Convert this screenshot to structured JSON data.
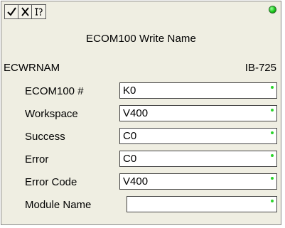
{
  "toolbar": {
    "buttons": [
      {
        "icon": "checkmark-icon"
      },
      {
        "icon": "cancel-icon"
      },
      {
        "icon": "help-icon"
      }
    ]
  },
  "status_led_color": "#18c818",
  "title": "ECOM100 Write Name",
  "mnemonic": "ECWRNAM",
  "ib_number": "IB-725",
  "fields": [
    {
      "label": "ECOM100 #",
      "value": "K0"
    },
    {
      "label": "Workspace",
      "value": "V400"
    },
    {
      "label": "Success",
      "value": "C0"
    },
    {
      "label": "Error",
      "value": "C0"
    },
    {
      "label": "Error Code",
      "value": "V400"
    },
    {
      "label": "Module Name",
      "value": ""
    }
  ]
}
